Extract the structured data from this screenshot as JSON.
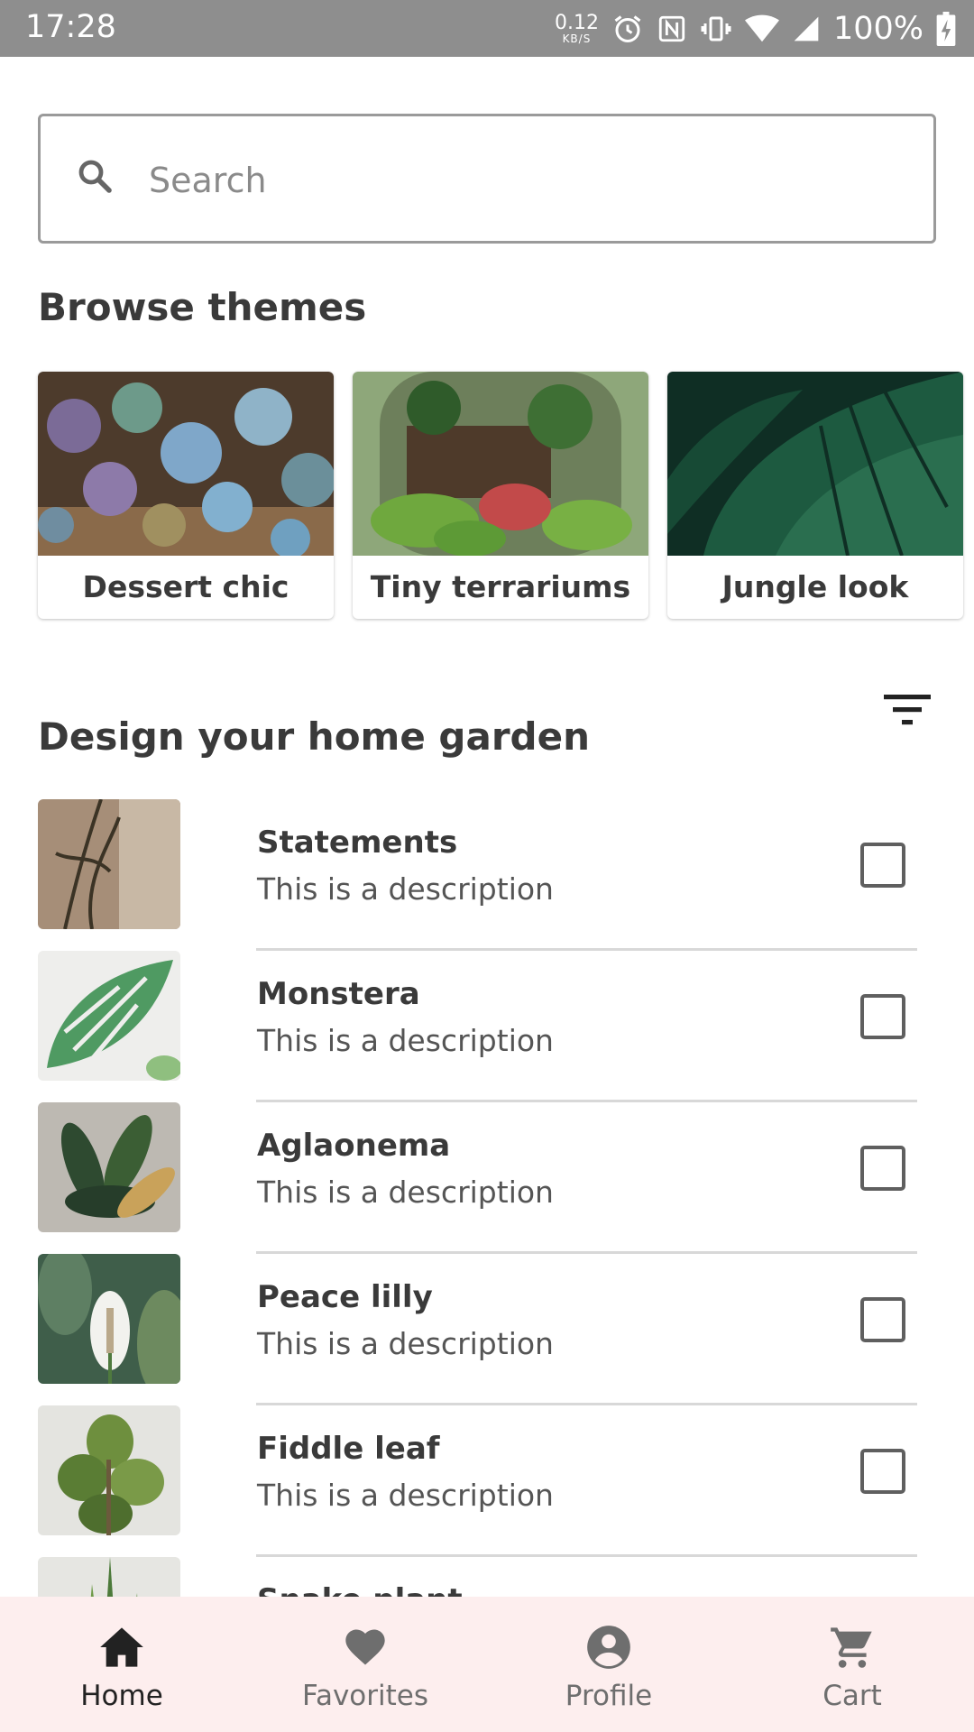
{
  "status_bar": {
    "time": "17:28",
    "network_speed": "0.12",
    "network_unit": "KB/S",
    "battery": "100%",
    "icons": [
      "alarm-icon",
      "nfc-icon",
      "vibrate-icon",
      "wifi-icon",
      "signal-icon",
      "battery-charging-icon"
    ]
  },
  "search": {
    "placeholder": "Search",
    "value": "",
    "icon": "search-icon"
  },
  "browse": {
    "title": "Browse themes",
    "themes": [
      {
        "label": "Dessert chic"
      },
      {
        "label": "Tiny terrariums"
      },
      {
        "label": "Jungle look"
      }
    ]
  },
  "garden": {
    "title": "Design your home garden",
    "filter_icon": "filter-icon",
    "items": [
      {
        "title": "Statements",
        "description": "This is a description",
        "checked": false
      },
      {
        "title": "Monstera",
        "description": "This is a description",
        "checked": false
      },
      {
        "title": "Aglaonema",
        "description": "This is a description",
        "checked": false
      },
      {
        "title": "Peace lilly",
        "description": "This is a description",
        "checked": false
      },
      {
        "title": "Fiddle leaf",
        "description": "This is a description",
        "checked": false
      },
      {
        "title": "Snake plant",
        "description": "",
        "checked": false
      }
    ]
  },
  "bottom_nav": {
    "items": [
      {
        "label": "Home",
        "icon": "home-icon",
        "active": true
      },
      {
        "label": "Favorites",
        "icon": "heart-icon",
        "active": false
      },
      {
        "label": "Profile",
        "icon": "account-circle-icon",
        "active": false
      },
      {
        "label": "Cart",
        "icon": "cart-icon",
        "active": false
      }
    ]
  },
  "colors": {
    "status_bar": "#8e8e8e",
    "bottom_nav_bg": "#fdeeee",
    "text_primary": "#3a3a3a",
    "nav_active": "#222222",
    "nav_inactive": "#6e6e6e"
  }
}
